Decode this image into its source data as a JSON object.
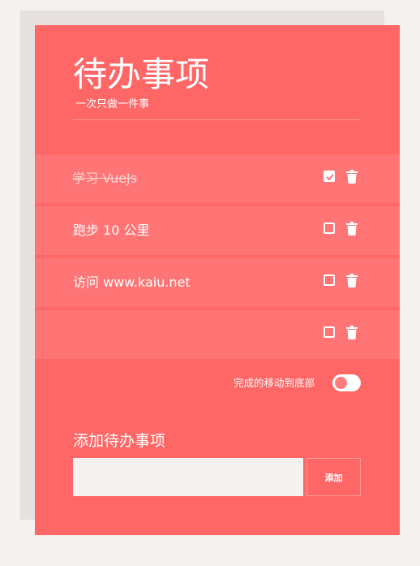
{
  "header": {
    "title": "待办事项",
    "subtitle": "一次只做一件事"
  },
  "todos": [
    {
      "text": "学习 VueJs",
      "done": true
    },
    {
      "text": "跑步 10 公里",
      "done": false
    },
    {
      "text": "访问 www.kaiu.net",
      "done": false
    },
    {
      "text": "",
      "done": false
    }
  ],
  "icons": {
    "checkbox": "checkbox-icon",
    "delete": "trash-icon"
  },
  "settings": {
    "move_done_label": "完成的移动到底部",
    "move_done_enabled": false
  },
  "add": {
    "heading": "添加待办事项",
    "input_value": "",
    "button_label": "添加"
  },
  "colors": {
    "card": "#ff6666",
    "row": "#ff7474",
    "background": "#f6f1f1"
  }
}
